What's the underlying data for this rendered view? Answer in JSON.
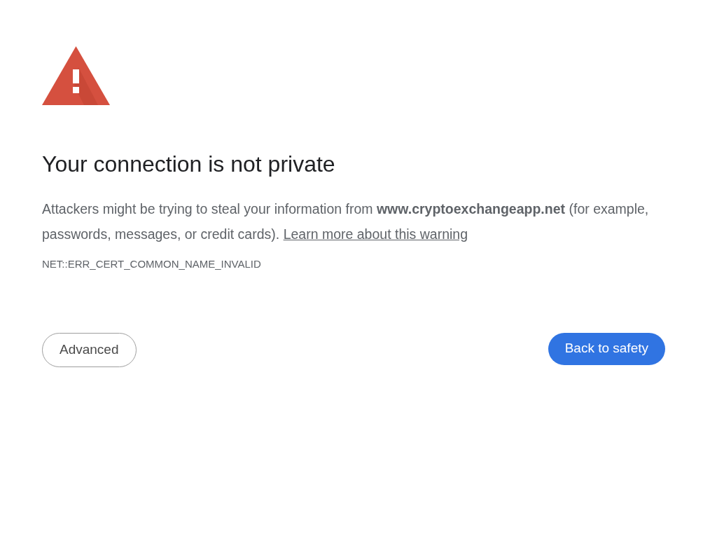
{
  "heading": "Your connection is not private",
  "message": "Attackers might be trying to steal your information from **www.cryptoexchangeapp.net** (for example, passwords, messages, or credit cards).",
  "learn_more_link": "Learn more about this warning",
  "error_code": "NET::ERR_CERT_COMMON_NAME_INVALID",
  "buttons": [
    {
      "label": "Advanced",
      "kind": "secondary"
    },
    {
      "label": "Back to safety",
      "kind": "primary"
    }
  ]
}
